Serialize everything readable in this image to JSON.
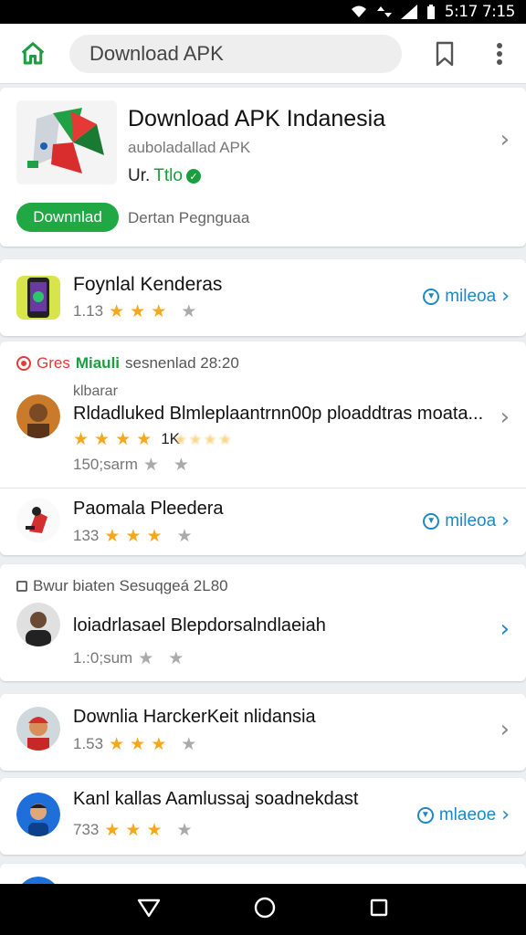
{
  "status": {
    "time": "5:17 7:15"
  },
  "appbar": {
    "search_text": "Download APK",
    "icons": {
      "home": "home-icon",
      "bookmark": "bookmark-icon",
      "more": "more-vert-icon"
    }
  },
  "featured": {
    "title": "Download APK Indanesia",
    "subtitle": "auboladallad APK",
    "dev_prefix": "Ur.",
    "dev_name": "Ttlo",
    "download_label": "Downnlad",
    "note": "Dertan Pegnguaa"
  },
  "rows": [
    {
      "title": "Foynlal  Kenderas",
      "rating": "1.13",
      "install_label": "mileoa"
    },
    {
      "section": {
        "red": "Gres",
        "green": "Miauli",
        "rest": "sesnenlad 28:20"
      },
      "small_label": "klbarar",
      "title": "Rldadluked Blmleplaantrnn00p ploaddtras moata...",
      "stars_text": "1K",
      "meta": "150;sarm"
    },
    {
      "title": "Paomala Pleedera",
      "rating": "133",
      "install_label": "mileoa"
    },
    {
      "section": {
        "rest": "Bwur biaten Sesuqgeá 2L80"
      },
      "title": "loiadrlasael Blepdorsalndlaeiah",
      "meta": "1.:0;sum"
    },
    {
      "title": "Downlia HarckerKeit nlidansia",
      "rating": "1.53"
    },
    {
      "title": "Kanl kallas Aamlussaj soadnekdast",
      "rating": "733",
      "install_label": "mlaeoe"
    }
  ],
  "colors": {
    "accent_green": "#1fa844",
    "link_blue": "#1e88c7",
    "star": "#f4a81c"
  }
}
